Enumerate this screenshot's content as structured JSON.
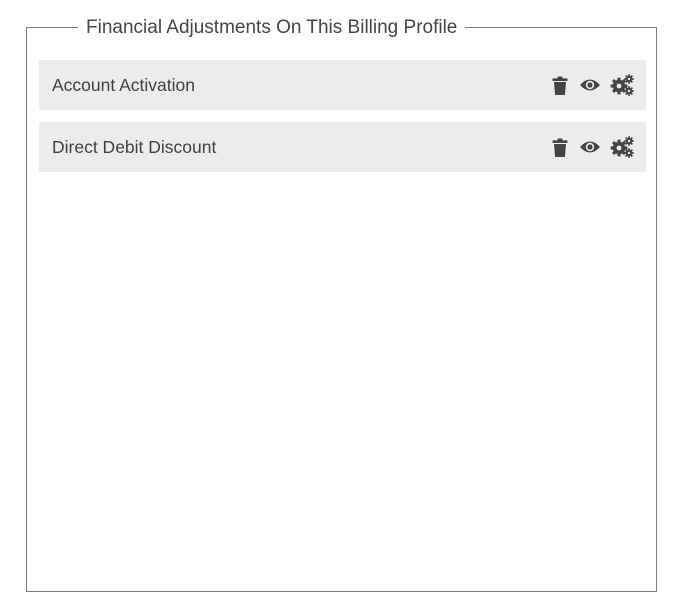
{
  "panel": {
    "title": "Financial Adjustments On This Billing Profile"
  },
  "adjustments": [
    {
      "label": "Account Activation"
    },
    {
      "label": "Direct Debit Discount"
    }
  ],
  "icons": {
    "delete": "trash-icon",
    "view": "eye-icon",
    "settings": "gears-icon"
  },
  "colors": {
    "row_background": "#ececec",
    "icon": "#444444",
    "border": "#7a7a7a"
  }
}
